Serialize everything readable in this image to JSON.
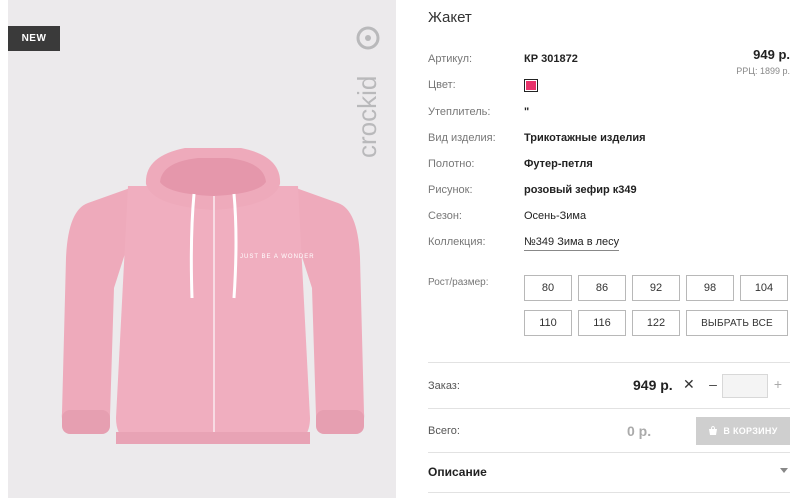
{
  "product": {
    "title": "Жакет",
    "badge": "NEW",
    "brand": "crockid",
    "image_print_text": "JUST BE A WONDER"
  },
  "pricing": {
    "price": "949 р.",
    "rrp": "РРЦ: 1899 р."
  },
  "attributes": [
    {
      "label": "Артикул:",
      "value": "КР 301872"
    },
    {
      "label": "Цвет:",
      "value": ""
    },
    {
      "label": "Утеплитель:",
      "value": "\""
    },
    {
      "label": "Вид изделия:",
      "value": "Трикотажные изделия"
    },
    {
      "label": "Полотно:",
      "value": "Футер-петля"
    },
    {
      "label": "Рисунок:",
      "value": "розовый зефир к349"
    },
    {
      "label": "Сезон:",
      "value": "Осень-Зима"
    },
    {
      "label": "Коллекция:",
      "value": "№349 Зима в лесу"
    }
  ],
  "colors": {
    "swatch": "#e8336b",
    "photo_bg": "#eceaec",
    "jacket": "#eeaabb",
    "badge_bg": "#3a3a3a"
  },
  "sizes": {
    "label": "Рост/размер:",
    "options": [
      "80",
      "86",
      "92",
      "98",
      "104",
      "110",
      "116",
      "122"
    ],
    "select_all": "ВЫБРАТЬ ВСЕ"
  },
  "order": {
    "label": "Заказ:",
    "price": "949 р.",
    "times": "✕",
    "minus": "–",
    "plus": "+",
    "quantity": ""
  },
  "total": {
    "label": "Всего:",
    "value": "0 р.",
    "cart_button": "В КОРЗИНУ",
    "cart_icon": "cart-icon"
  },
  "description": {
    "label": "Описание",
    "expand_icon": "caret-down-icon"
  }
}
